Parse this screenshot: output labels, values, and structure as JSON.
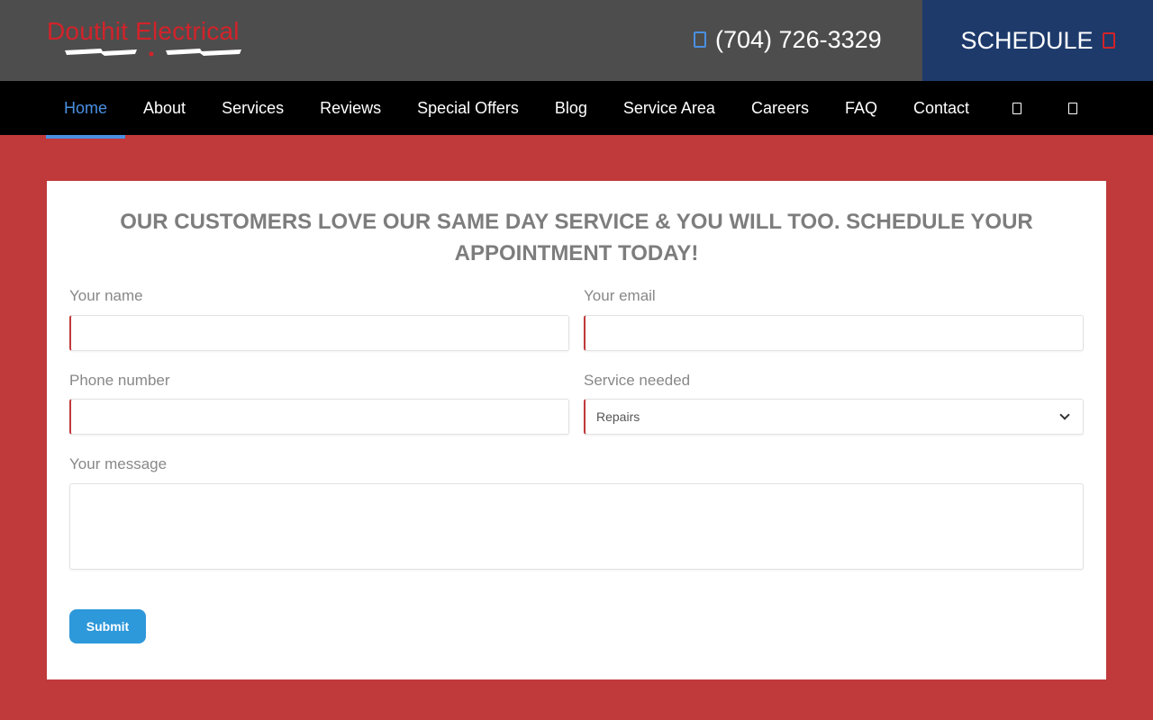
{
  "header": {
    "logo_text": "Douthit Electrical",
    "phone": "(704) 726-3329",
    "phone_icon": "phone-icon",
    "schedule_label": "SCHEDULE",
    "schedule_icon": "calendar-icon"
  },
  "nav": {
    "items": [
      {
        "label": "Home",
        "active": true
      },
      {
        "label": "About"
      },
      {
        "label": "Services"
      },
      {
        "label": "Reviews"
      },
      {
        "label": "Special Offers"
      },
      {
        "label": "Blog"
      },
      {
        "label": "Service Area"
      },
      {
        "label": "Careers"
      },
      {
        "label": "FAQ"
      },
      {
        "label": "Contact"
      }
    ],
    "icons": [
      "facebook-icon",
      "google-icon"
    ]
  },
  "form": {
    "title": "OUR CUSTOMERS LOVE OUR SAME DAY SERVICE & YOU WILL TOO. SCHEDULE YOUR APPOINTMENT TODAY!",
    "name_label": "Your name",
    "email_label": "Your email",
    "phone_label": "Phone number",
    "service_label": "Service needed",
    "service_value": "Repairs",
    "message_label": "Your message",
    "submit_label": "Submit"
  },
  "colors": {
    "header_bg": "#4d4d4d",
    "schedule_bg": "#1d3a6b",
    "nav_bg": "#000000",
    "page_bg": "#c0393b",
    "accent_blue": "#4a90e2",
    "brand_red": "#d2232a",
    "submit_bg": "#2d98da"
  }
}
